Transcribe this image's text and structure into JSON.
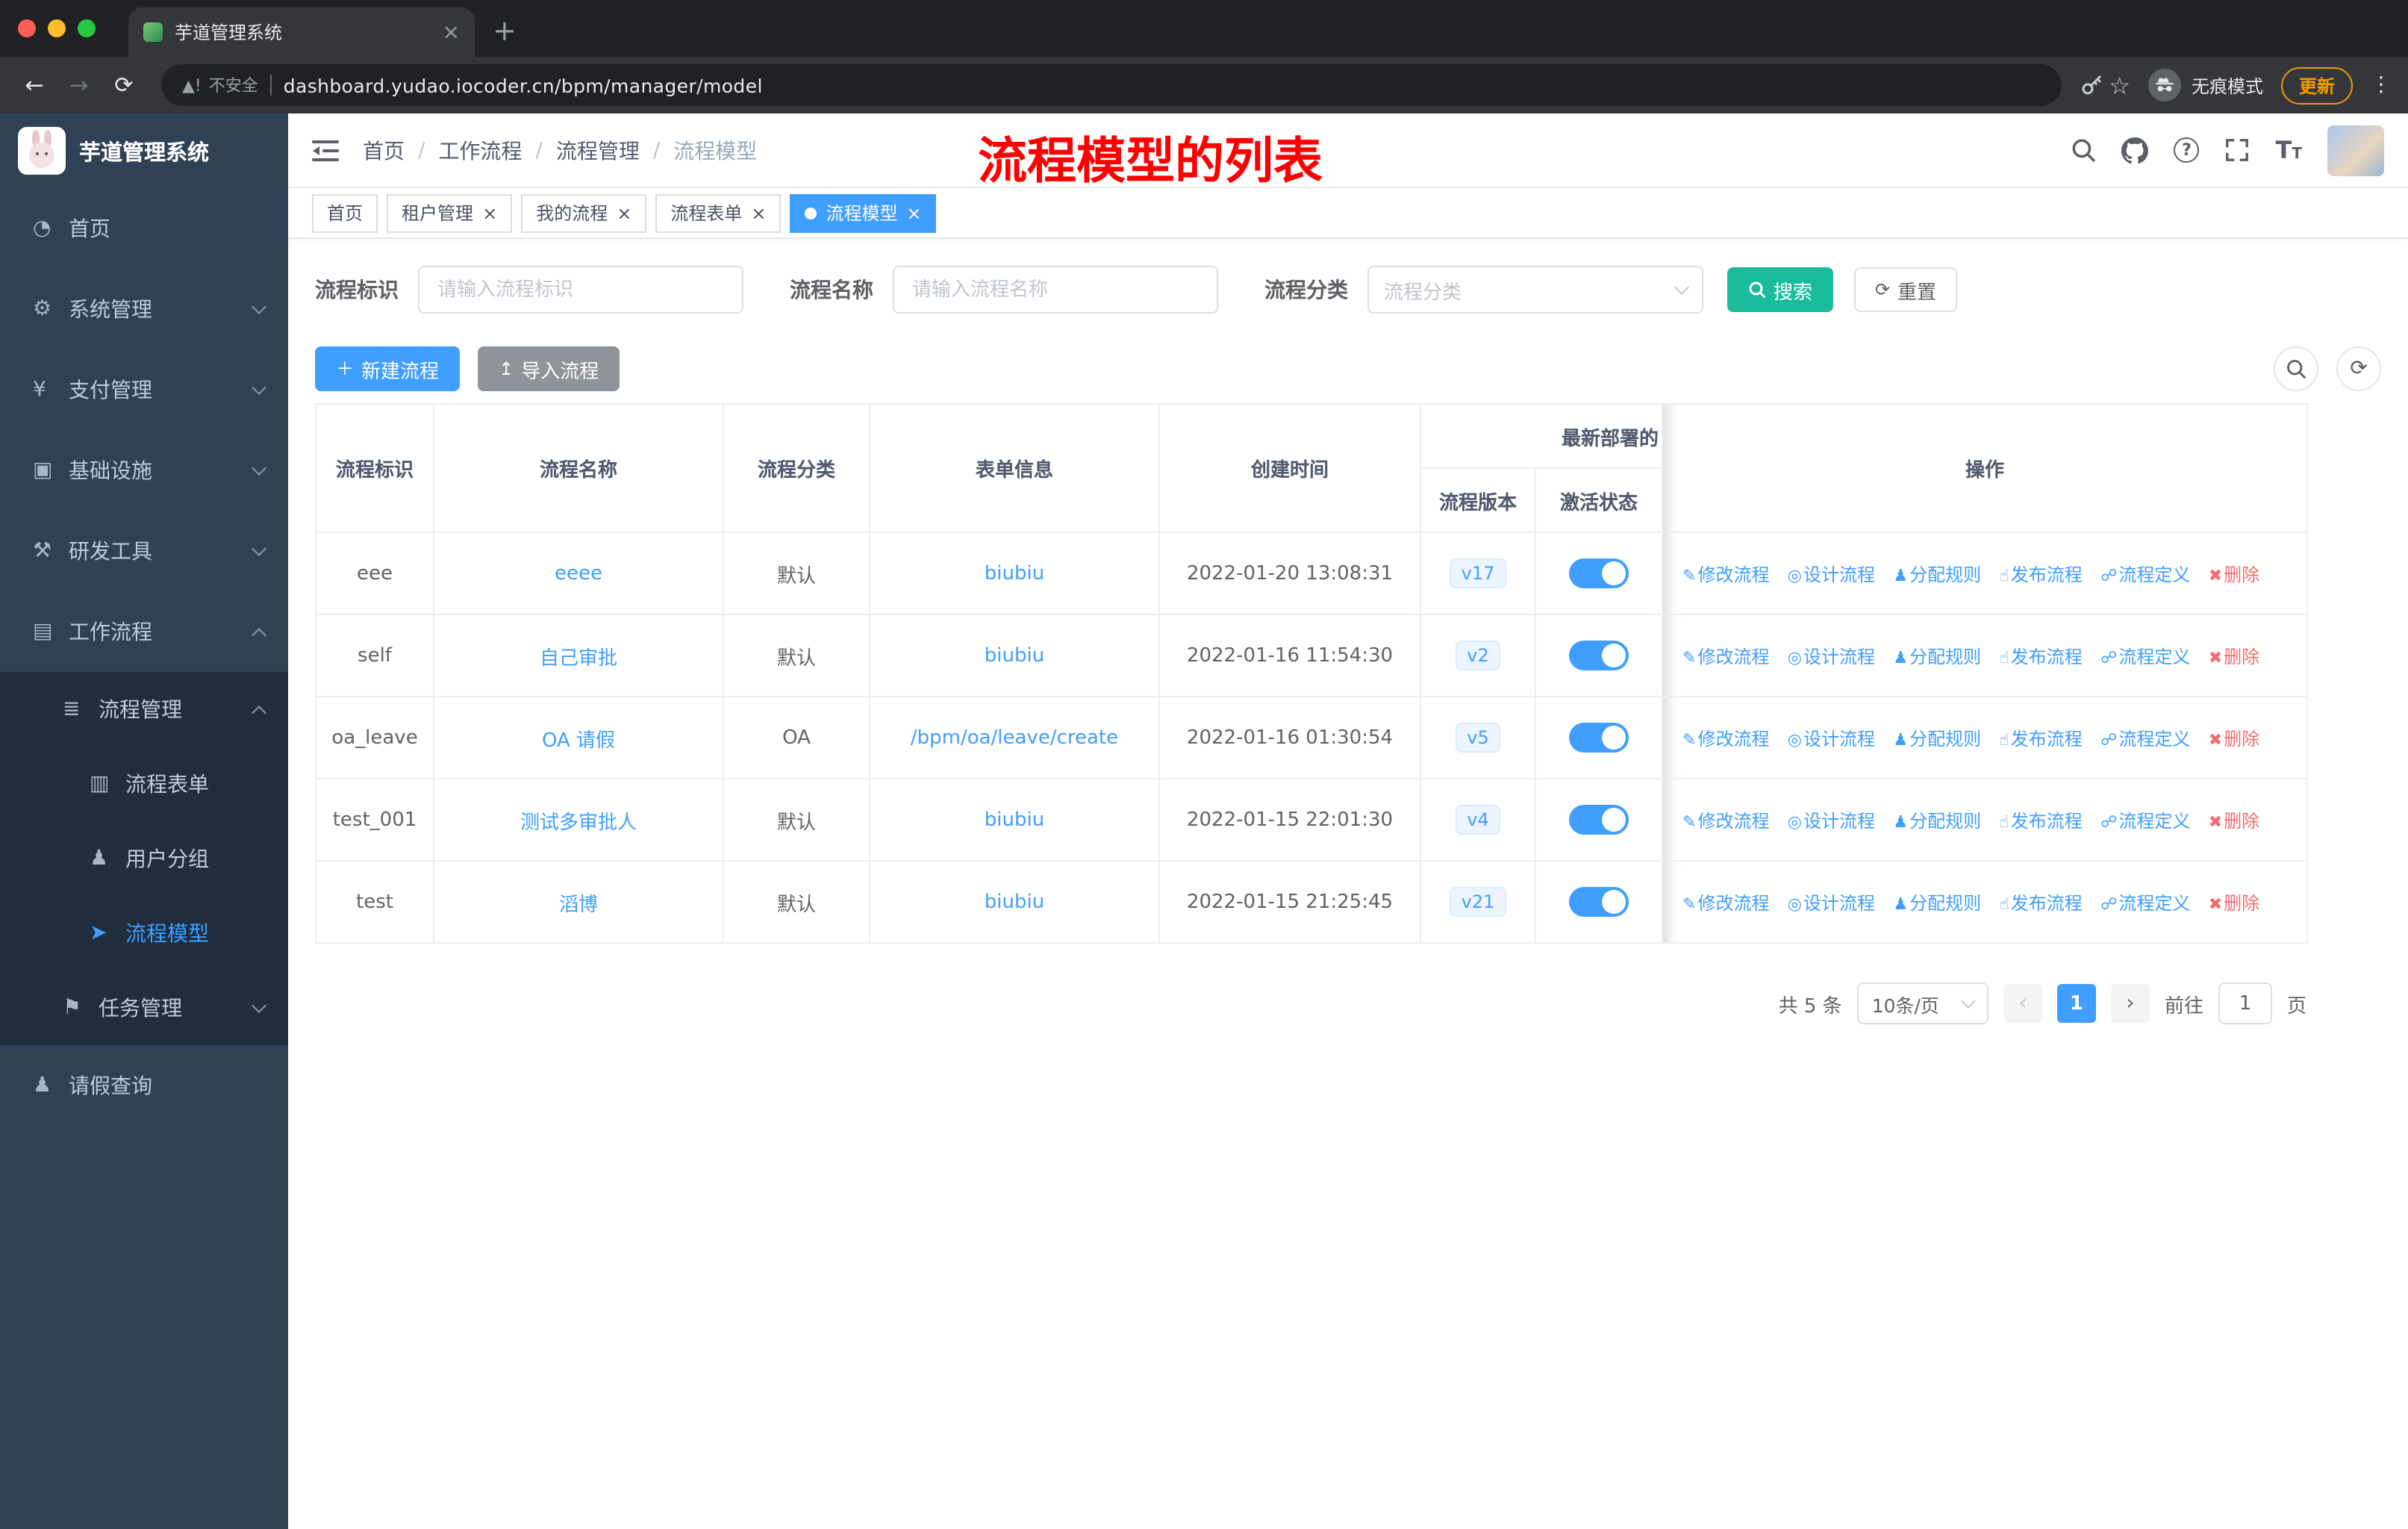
{
  "browser": {
    "tab_title": "芋道管理系统",
    "security_label": "不安全",
    "url": "dashboard.yudao.iocoder.cn/bpm/manager/model",
    "incognito_label": "无痕模式",
    "update_label": "更新"
  },
  "sidebar": {
    "title": "芋道管理系统",
    "items": {
      "home": "首页",
      "system": "系统管理",
      "payment": "支付管理",
      "infra": "基础设施",
      "devtools": "研发工具",
      "workflow": "工作流程",
      "process_mgmt": "流程管理",
      "process_form": "流程表单",
      "user_group": "用户分组",
      "process_model": "流程模型",
      "task_mgmt": "任务管理",
      "leave_query": "请假查询"
    }
  },
  "breadcrumb": [
    "首页",
    "工作流程",
    "流程管理",
    "流程模型"
  ],
  "annotation": "流程模型的列表",
  "tags": [
    "首页",
    "租户管理",
    "我的流程",
    "流程表单",
    "流程模型"
  ],
  "filters": {
    "id_label": "流程标识",
    "id_placeholder": "请输入流程标识",
    "name_label": "流程名称",
    "name_placeholder": "请输入流程名称",
    "category_label": "流程分类",
    "category_placeholder": "流程分类",
    "search_label": "搜索",
    "reset_label": "重置"
  },
  "toolbar": {
    "create_label": "新建流程",
    "import_label": "导入流程"
  },
  "table": {
    "headers": {
      "id": "流程标识",
      "name": "流程名称",
      "category": "流程分类",
      "form": "表单信息",
      "created": "创建时间",
      "deploy_group": "最新部署的",
      "version": "流程版本",
      "status": "激活状态",
      "ops": "操作"
    },
    "action_labels": [
      "修改流程",
      "设计流程",
      "分配规则",
      "发布流程",
      "流程定义",
      "删除"
    ],
    "rows": [
      {
        "id": "eee",
        "name": "eeee",
        "category": "默认",
        "form": "biubiu",
        "created": "2022-01-20 13:08:31",
        "version": "v17"
      },
      {
        "id": "self",
        "name": "自己审批",
        "category": "默认",
        "form": "biubiu",
        "created": "2022-01-16 11:54:30",
        "version": "v2"
      },
      {
        "id": "oa_leave",
        "name": "OA 请假",
        "category": "OA",
        "form": "/bpm/oa/leave/create",
        "created": "2022-01-16 01:30:54",
        "version": "v5"
      },
      {
        "id": "test_001",
        "name": "测试多审批人",
        "category": "默认",
        "form": "biubiu",
        "created": "2022-01-15 22:01:30",
        "version": "v4"
      },
      {
        "id": "test",
        "name": "滔博",
        "category": "默认",
        "form": "biubiu",
        "created": "2022-01-15 21:25:45",
        "version": "v21"
      }
    ]
  },
  "pagination": {
    "total": "共 5 条",
    "page_size": "10条/页",
    "current_page": "1",
    "goto_label": "前往",
    "goto_value": "1",
    "page_unit": "页"
  }
}
